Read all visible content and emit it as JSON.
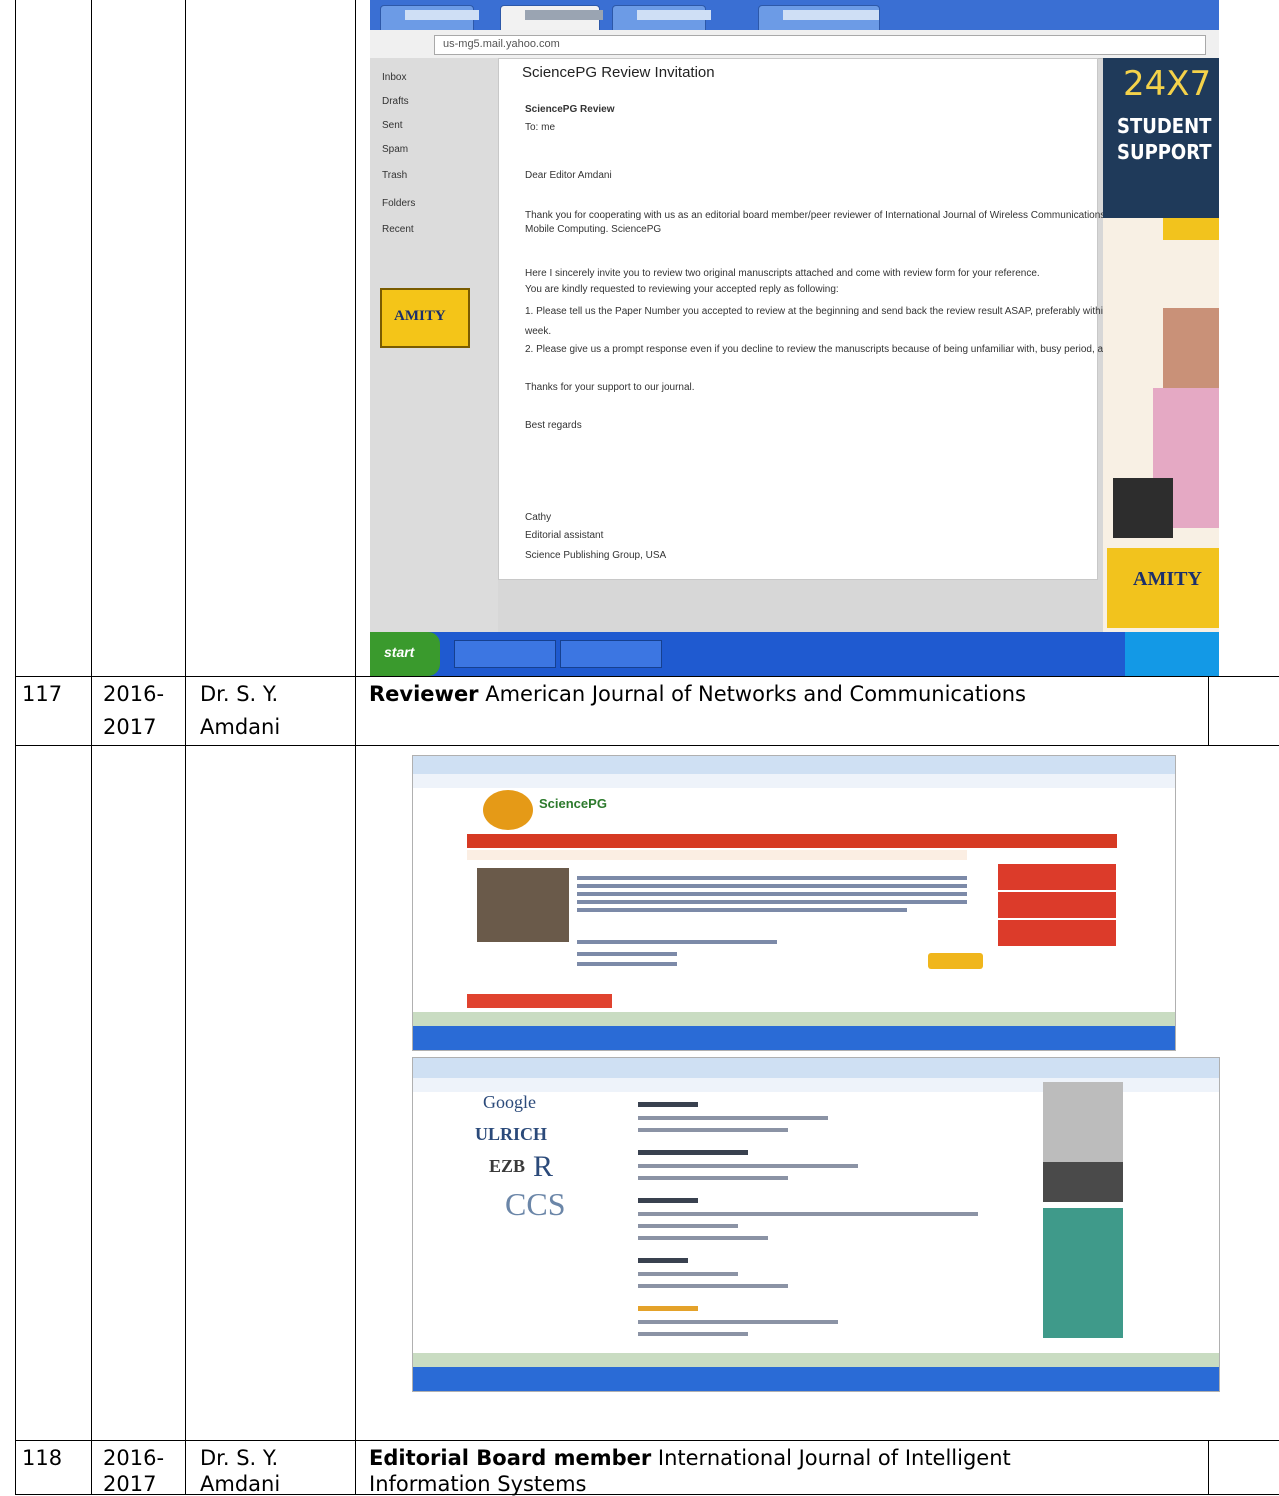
{
  "rows": [
    {
      "no": "117",
      "year_a": "2016-",
      "year_b": "2017",
      "name_a": "Dr. S. Y.",
      "name_b": "Amdani",
      "role": "Reviewer",
      "desc": " American Journal of Networks and Communications"
    },
    {
      "no": "118",
      "year_a": "2016-",
      "year_b": "2017",
      "name_a": "Dr. S. Y.",
      "name_b": "Amdani",
      "role": "Editorial Board member",
      "desc_a": " International Journal of Intelligent",
      "desc_b": "Information Systems"
    }
  ],
  "shot1": {
    "url": "us-mg5.mail.yahoo.com",
    "subject": "SciencePG Review Invitation",
    "sender": "SciencePG Review",
    "to": "To: me",
    "greeting": "Dear Editor Amdani",
    "body": [
      "Thank you for cooperating with us as an editorial board member/peer reviewer of International Journal of Wireless Communications and",
      "Mobile Computing. SciencePG",
      "Here I sincerely invite you to review two original manuscripts attached and come with review form for your reference.",
      "You are kindly requested to reviewing your accepted reply as following:",
      "1. Please tell us the Paper Number you accepted to review at the beginning and send back the review result ASAP, preferably within one",
      "week.",
      "2. Please give us a prompt response even if you decline to review the manuscripts because of being unfamiliar with, busy period, and so on.",
      "Thanks for your support to our journal.",
      "Best regards",
      "Cathy",
      "Editorial assistant",
      "Science Publishing Group, USA"
    ],
    "sidebar": [
      "Inbox",
      "Drafts",
      "Sent",
      "Spam",
      "Trash",
      "Folders",
      "Recent"
    ],
    "ad_num": "24X7",
    "ad_l1": "STUDENT",
    "ad_l2": "SUPPORT",
    "ad_brand": "AMITY",
    "start": "start"
  },
  "shot2": {
    "brand": "SciencePG"
  },
  "shot3": {
    "logo1": "Google",
    "logo2": "ULRICH",
    "logo3": "EZB",
    "logo4": "R",
    "logo5": "CCS"
  }
}
